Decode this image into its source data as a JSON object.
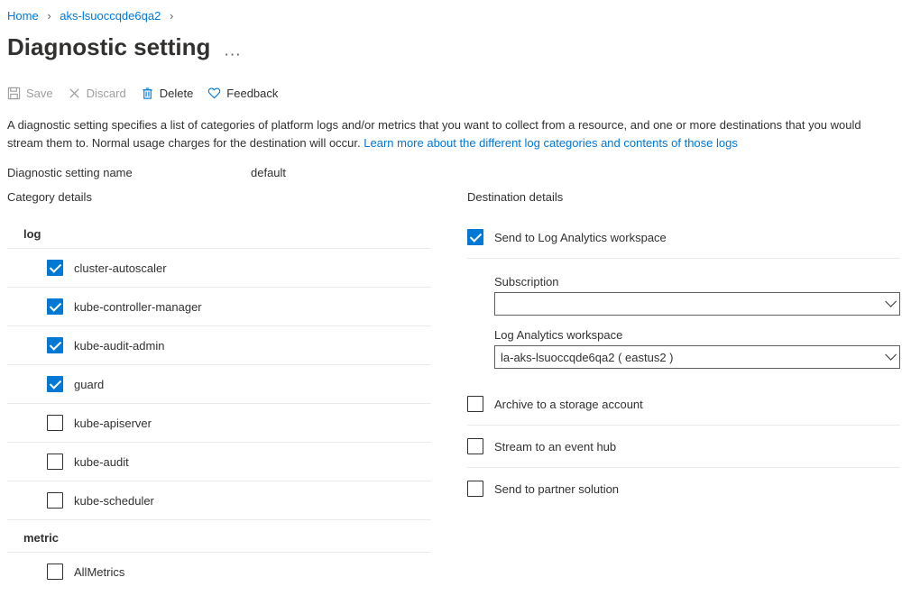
{
  "breadcrumb": {
    "home": "Home",
    "resource": "aks-lsuoccqde6qa2"
  },
  "page": {
    "title": "Diagnostic setting"
  },
  "toolbar": {
    "save": "Save",
    "discard": "Discard",
    "delete": "Delete",
    "feedback": "Feedback"
  },
  "description": {
    "text": "A diagnostic setting specifies a list of categories of platform logs and/or metrics that you want to collect from a resource, and one or more destinations that you would stream them to. Normal usage charges for the destination will occur. ",
    "link": "Learn more about the different log categories and contents of those logs"
  },
  "settingName": {
    "label": "Diagnostic setting name",
    "value": "default"
  },
  "category": {
    "title": "Category details",
    "logHeader": "log",
    "metricHeader": "metric",
    "logs": [
      {
        "name": "cluster-autoscaler",
        "checked": true
      },
      {
        "name": "kube-controller-manager",
        "checked": true
      },
      {
        "name": "kube-audit-admin",
        "checked": true
      },
      {
        "name": "guard",
        "checked": true
      },
      {
        "name": "kube-apiserver",
        "checked": false
      },
      {
        "name": "kube-audit",
        "checked": false
      },
      {
        "name": "kube-scheduler",
        "checked": false
      }
    ],
    "metrics": [
      {
        "name": "AllMetrics",
        "checked": false
      }
    ]
  },
  "destination": {
    "title": "Destination details",
    "logAnalytics": {
      "label": "Send to Log Analytics workspace",
      "checked": true
    },
    "subscription": {
      "label": "Subscription",
      "value": ""
    },
    "workspace": {
      "label": "Log Analytics workspace",
      "value": "la-aks-lsuoccqde6qa2 ( eastus2 )"
    },
    "storage": {
      "label": "Archive to a storage account",
      "checked": false
    },
    "eventhub": {
      "label": "Stream to an event hub",
      "checked": false
    },
    "partner": {
      "label": "Send to partner solution",
      "checked": false
    }
  }
}
